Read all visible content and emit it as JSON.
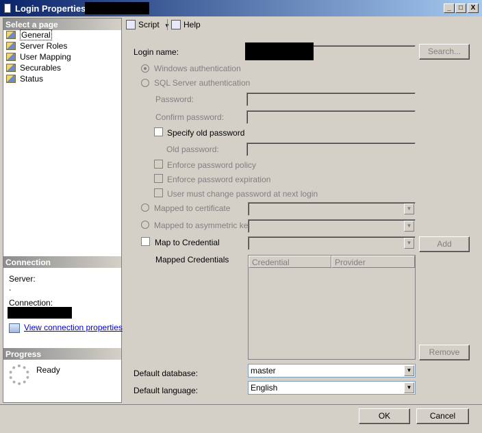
{
  "window": {
    "title": "Login Properties -",
    "controls": [
      "_",
      "□",
      "X"
    ]
  },
  "left": {
    "select_page_header": "Select a page",
    "pages": [
      "General",
      "Server Roles",
      "User Mapping",
      "Securables",
      "Status"
    ],
    "connection_header": "Connection",
    "server_label": "Server:",
    "server_value": ".",
    "connection_label": "Connection:",
    "view_connection_link": "View connection properties",
    "progress_header": "Progress",
    "progress_status": "Ready"
  },
  "toolbar": {
    "script_label": "Script",
    "help_label": "Help"
  },
  "form": {
    "login_name_label": "Login name:",
    "search_button": "Search...",
    "windows_auth": "Windows authentication",
    "sql_auth": "SQL Server authentication",
    "password_label": "Password:",
    "confirm_password_label": "Confirm password:",
    "specify_old_password": "Specify old password",
    "old_password_label": "Old password:",
    "enforce_policy": "Enforce password policy",
    "enforce_expiration": "Enforce password expiration",
    "must_change": "User must change password at next login",
    "mapped_certificate": "Mapped to certificate",
    "mapped_asymmetric": "Mapped to asymmetric key",
    "map_credential": "Map to Credential",
    "add_button": "Add",
    "mapped_credentials_label": "Mapped Credentials",
    "cred_columns": [
      "Credential",
      "Provider"
    ],
    "remove_button": "Remove",
    "default_database_label": "Default database:",
    "default_database_value": "master",
    "default_language_label": "Default language:",
    "default_language_value": "English"
  },
  "footer": {
    "ok_button": "OK",
    "cancel_button": "Cancel"
  }
}
